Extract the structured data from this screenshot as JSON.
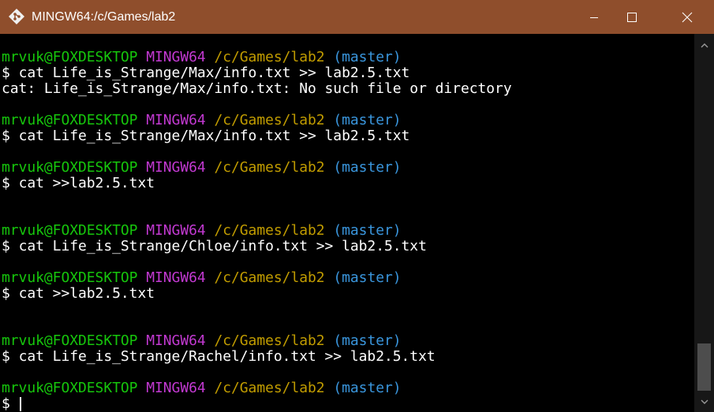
{
  "window": {
    "title": "MINGW64:/c/Games/lab2",
    "icon": "git-bash-diamond-icon",
    "colors": {
      "titlebar": "#8f4e2c",
      "background": "#000000",
      "user": "#16c60c",
      "system": "#c239d1",
      "path": "#c19c00",
      "branch": "#3a96dd",
      "text": "#ffffff"
    }
  },
  "prompt": {
    "user_host": "mrvuk@FOXDESKTOP",
    "system": "MINGW64",
    "path": "/c/Games/lab2",
    "branch": "(master)",
    "symbol": "$"
  },
  "lines": [
    {
      "kind": "prompt"
    },
    {
      "kind": "command",
      "text": "cat Life_is_Strange/Max/info.txt >> lab2.5.txt"
    },
    {
      "kind": "output",
      "text": "cat: Life_is_Strange/Max/info.txt: No such file or directory"
    },
    {
      "kind": "blank"
    },
    {
      "kind": "prompt"
    },
    {
      "kind": "command",
      "text": "cat Life_is_Strange/Max/info.txt >> lab2.5.txt"
    },
    {
      "kind": "blank"
    },
    {
      "kind": "prompt"
    },
    {
      "kind": "command",
      "text": "cat >>lab2.5.txt"
    },
    {
      "kind": "blank"
    },
    {
      "kind": "blank"
    },
    {
      "kind": "prompt"
    },
    {
      "kind": "command",
      "text": "cat Life_is_Strange/Chloe/info.txt >> lab2.5.txt"
    },
    {
      "kind": "blank"
    },
    {
      "kind": "prompt"
    },
    {
      "kind": "command",
      "text": "cat >>lab2.5.txt"
    },
    {
      "kind": "blank"
    },
    {
      "kind": "blank"
    },
    {
      "kind": "prompt"
    },
    {
      "kind": "command",
      "text": "cat Life_is_Strange/Rachel/info.txt >> lab2.5.txt"
    },
    {
      "kind": "blank"
    },
    {
      "kind": "prompt"
    },
    {
      "kind": "cursor"
    }
  ]
}
